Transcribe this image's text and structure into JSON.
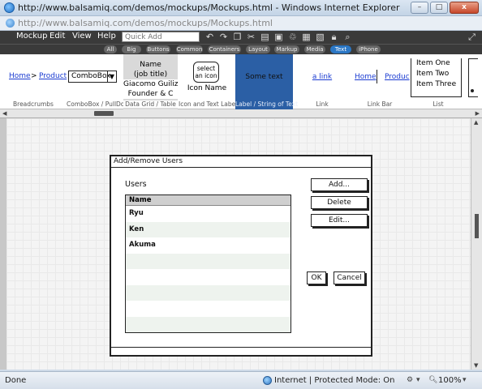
{
  "window": {
    "title": "http://www.balsamiq.com/demos/mockups/Mockups.html - Windows Internet Explorer",
    "url": "http://www.balsamiq.com/demos/mockups/Mockups.html",
    "buttons": {
      "minimize": "–",
      "maximize": "□",
      "close": "x"
    }
  },
  "menubar": {
    "items": [
      "Mockup",
      "Edit",
      "View",
      "Help"
    ],
    "quick_add_placeholder": "Quick Add"
  },
  "categories": [
    "All",
    "Big",
    "Buttons",
    "Common",
    "Containers",
    "Layout",
    "Markup",
    "Media",
    "Text",
    "iPhone"
  ],
  "active_category": "Text",
  "components": {
    "breadcrumbs": {
      "crumb1": "Home",
      "sep": ">",
      "crumb2": "Product",
      "label": "Breadcrumbs"
    },
    "combobox": {
      "text": "ComboBox",
      "arrow": "▼",
      "label": "ComboBox / PullDo..."
    },
    "datagrid": {
      "line1": "Name",
      "line2": "(job title)",
      "line3": "Giacomo Guiliz",
      "line4": "Founder & C",
      "label": "Data Grid / Table"
    },
    "iconlabel": {
      "bubble": "select an icon",
      "name": "Icon Name",
      "label": "Icon and Text Label"
    },
    "labeltext": {
      "text": "Some text",
      "label": "Label / String of Text"
    },
    "link": {
      "text": "a link",
      "label": "Link"
    },
    "linkbar": {
      "l1": "Home",
      "l2": "Produc",
      "label": "Link Bar"
    },
    "list": {
      "i1": "Item One",
      "i2": "Item Two",
      "i3": "Item Three",
      "label": "List"
    }
  },
  "mockup": {
    "dialog_title": "Add/Remove Users",
    "users_label": "Users",
    "list_header": "Name",
    "users": [
      "Ryu",
      "Ken",
      "Akuma",
      "",
      "",
      "",
      "",
      ""
    ],
    "buttons": {
      "add": "Add...",
      "delete": "Delete",
      "edit": "Edit...",
      "ok": "OK",
      "cancel": "Cancel"
    }
  },
  "statusbar": {
    "status": "Done",
    "zone": "Internet | Protected Mode: On",
    "zoom": "100%"
  }
}
